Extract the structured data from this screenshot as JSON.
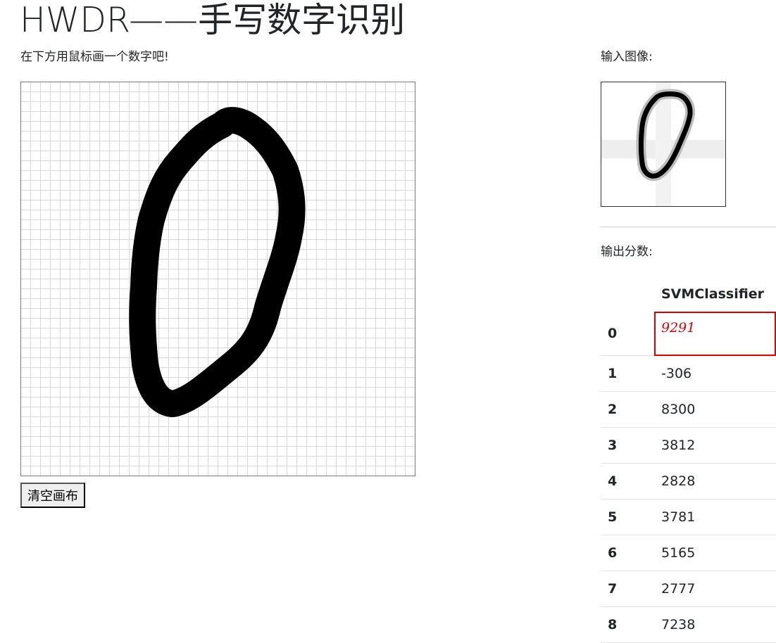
{
  "header": {
    "title": "HWDR——手写数字识别",
    "instruction": "在下方用鼠标画一个数字吧!"
  },
  "canvas": {
    "clear_button_label": "清空画布"
  },
  "sidebar": {
    "input_label": "输入图像:",
    "output_label": "输出分数:"
  },
  "scores": {
    "column_header": "SVMClassifier",
    "best_digit": "0",
    "rows": [
      {
        "digit": "0",
        "value": "9291"
      },
      {
        "digit": "1",
        "value": "-306"
      },
      {
        "digit": "2",
        "value": "8300"
      },
      {
        "digit": "3",
        "value": "3812"
      },
      {
        "digit": "4",
        "value": "2828"
      },
      {
        "digit": "5",
        "value": "3781"
      },
      {
        "digit": "6",
        "value": "5165"
      },
      {
        "digit": "7",
        "value": "2777"
      },
      {
        "digit": "8",
        "value": "7238"
      }
    ]
  },
  "colors": {
    "highlight": "#e00000",
    "text": "#212529",
    "grid": "#d9d9d9"
  }
}
